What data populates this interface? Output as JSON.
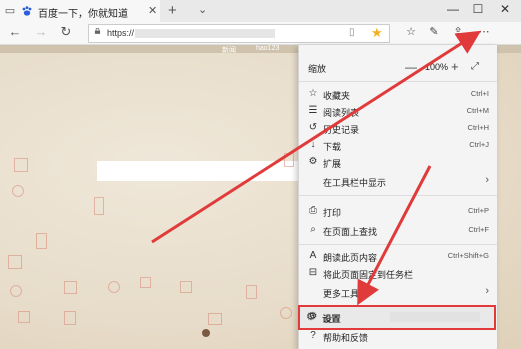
{
  "tab": {
    "title": "百度一下，你就知道"
  },
  "address": {
    "url": "https://",
    "url_hidden_note": ""
  },
  "page": {
    "strip_left": "新闻",
    "strip_right": "hao123"
  },
  "menu": {
    "zoom_label": "缩放",
    "zoom_value": "100%",
    "items": [
      {
        "icon": "star-list-icon",
        "label": "收藏夹",
        "shortcut": "Ctrl+I"
      },
      {
        "icon": "reading-list-icon",
        "label": "阅读列表",
        "shortcut": "Ctrl+M"
      },
      {
        "icon": "history-icon",
        "label": "历史记录",
        "shortcut": "Ctrl+H"
      },
      {
        "icon": "download-icon",
        "label": "下载",
        "shortcut": "Ctrl+J"
      },
      {
        "icon": "extensions-icon",
        "label": "扩展",
        "shortcut": ""
      },
      {
        "icon": "",
        "label": "在工具栏中显示",
        "shortcut": ""
      },
      {
        "icon": "print-icon",
        "label": "打印",
        "shortcut": "Ctrl+P"
      },
      {
        "icon": "find-icon",
        "label": "在页面上查找",
        "shortcut": "Ctrl+F"
      },
      {
        "icon": "read-aloud-icon",
        "label": "朗读此页内容",
        "shortcut": "Ctrl+Shift+G"
      },
      {
        "icon": "pin-taskbar-icon",
        "label": "将此页面固定到任务栏",
        "shortcut": ""
      },
      {
        "icon": "",
        "label": "更多工具",
        "shortcut": ""
      },
      {
        "icon": "gear-icon",
        "label": "设置",
        "shortcut": ""
      },
      {
        "icon": "help-icon",
        "label": "帮助和反馈",
        "shortcut": ""
      }
    ]
  },
  "colors": {
    "highlight": "#e23a3a",
    "star": "#f2b01e"
  }
}
